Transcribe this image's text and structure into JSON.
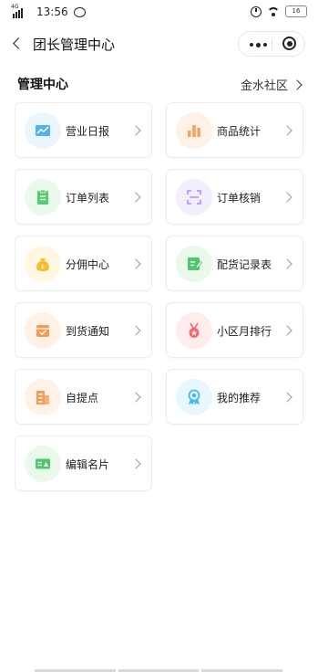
{
  "status_bar": {
    "network": "4G",
    "time": "13:56",
    "battery": "16"
  },
  "nav": {
    "title": "团长管理中心"
  },
  "section": {
    "title": "管理中心",
    "community": "金水社区"
  },
  "menu_items": [
    {
      "label": "营业日报",
      "icon": "trend-chart-icon",
      "bg": "#eaf5fd",
      "color": "#52b0ef"
    },
    {
      "label": "商品统计",
      "icon": "bar-chart-icon",
      "bg": "#fff1e6",
      "color": "#f5a25d"
    },
    {
      "label": "订单列表",
      "icon": "clipboard-icon",
      "bg": "#e9f9ec",
      "color": "#54cc72"
    },
    {
      "label": "订单核销",
      "icon": "scan-icon",
      "bg": "#f3eefe",
      "color": "#b28cf2"
    },
    {
      "label": "分佣中心",
      "icon": "money-bag-icon",
      "bg": "#fff7e1",
      "color": "#f5bd2c"
    },
    {
      "label": "配货记录表",
      "icon": "edit-doc-icon",
      "bg": "#e9f9ec",
      "color": "#4fc76d"
    },
    {
      "label": "到货通知",
      "icon": "calendar-check-icon",
      "bg": "#fff1e6",
      "color": "#f59b53"
    },
    {
      "label": "小区月排行",
      "icon": "medal-icon",
      "bg": "#ffecec",
      "color": "#f2686b"
    },
    {
      "label": "自提点",
      "icon": "building-icon",
      "bg": "#fff1e6",
      "color": "#f59b53"
    },
    {
      "label": "我的推荐",
      "icon": "award-ribbon-icon",
      "bg": "#e8f6fd",
      "color": "#42b9e8"
    },
    {
      "label": "编辑名片",
      "icon": "id-card-icon",
      "bg": "#e9f9ec",
      "color": "#4fc76d"
    }
  ]
}
